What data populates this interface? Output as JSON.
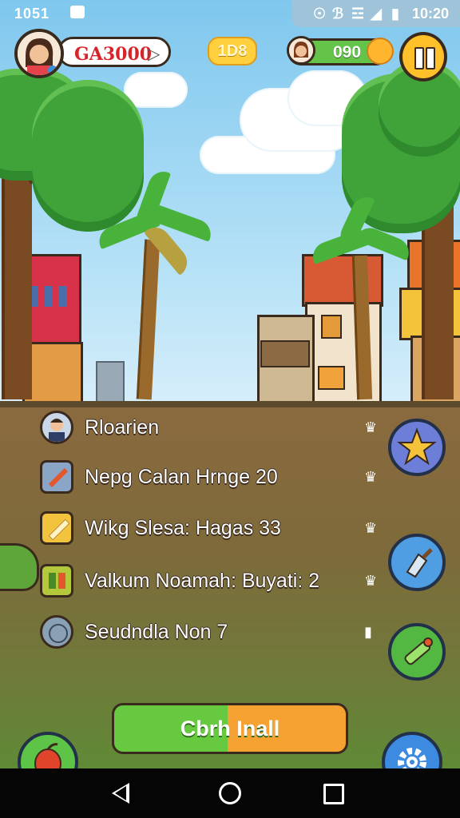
{
  "status_bar": {
    "time_left": "1051",
    "time_right": "10:20",
    "icons": [
      "sim-card-icon",
      "location-icon",
      "bluetooth-icon",
      "wifi-icon",
      "signal-icon",
      "battery-icon"
    ]
  },
  "hud": {
    "coins": "GA3000",
    "gold": "1D8",
    "energy": "090"
  },
  "menu": [
    {
      "label": "Rloarien",
      "icon": "player-portrait-icon"
    },
    {
      "label": "Nepg Calan Hrnge 20",
      "icon": "sword-icon"
    },
    {
      "label": "Wikg Slesa: Hagas 33",
      "icon": "pencil-icon"
    },
    {
      "label": "Valkum Noamah: Buyati: 2",
      "icon": "map-icon"
    },
    {
      "label": "Seudndla Non 7",
      "icon": "coin-icon"
    }
  ],
  "main_button": {
    "label": "Cbrh Inall"
  },
  "colors": {
    "sky": "#7fc7ee",
    "ground": "#7e6a3a",
    "button_green": "#66c93f",
    "button_orange": "#f5a233",
    "accent_red": "#d7262b"
  }
}
